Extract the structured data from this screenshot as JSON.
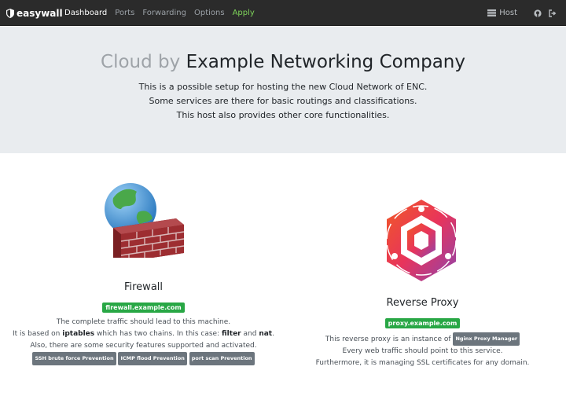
{
  "nav": {
    "brand": "easywall",
    "items": [
      {
        "label": "Dashboard"
      },
      {
        "label": "Ports"
      },
      {
        "label": "Forwarding"
      },
      {
        "label": "Options"
      },
      {
        "label": "Apply"
      }
    ],
    "host_label": "Host",
    "icons": [
      "server-icon",
      "github-icon",
      "logout-icon"
    ]
  },
  "hero": {
    "title_muted": "Cloud by",
    "title_main": "Example Networking Company",
    "lines": [
      "This is a possible setup for hosting the new Cloud Network of ENC.",
      "Some services are there for basic routings and classifications.",
      "This host also provides other core functionalities."
    ]
  },
  "firewall": {
    "title": "Firewall",
    "host": "firewall.example.com",
    "line1": "The complete traffic should lead to this machine.",
    "line2_a": "It is based on",
    "line2_b": "iptables",
    "line2_c": "which has two chains. In this case:",
    "line2_d": "filter",
    "line2_e": "and",
    "line2_f": "nat",
    "line2_g": ".",
    "line3": "Also, there are some security features supported and activated.",
    "tags": [
      "SSH brute force Prevention",
      "ICMP flood Prevention",
      "port scan Prevention"
    ]
  },
  "proxy": {
    "title": "Reverse Proxy",
    "host": "proxy.example.com",
    "line1": "This reverse proxy is an instance of",
    "line1_badge": "Nginx Proxy Manager",
    "line2": "Every web traffic should point to this service.",
    "line3": "Furthermore, it is managing SSL certificates for any domain."
  },
  "colors": {
    "navbar": "#2b2b2b",
    "apply": "#7ed35a",
    "jumbotron": "#e9ecef",
    "badge_success": "#28a745",
    "badge_secondary": "#6c757d"
  }
}
